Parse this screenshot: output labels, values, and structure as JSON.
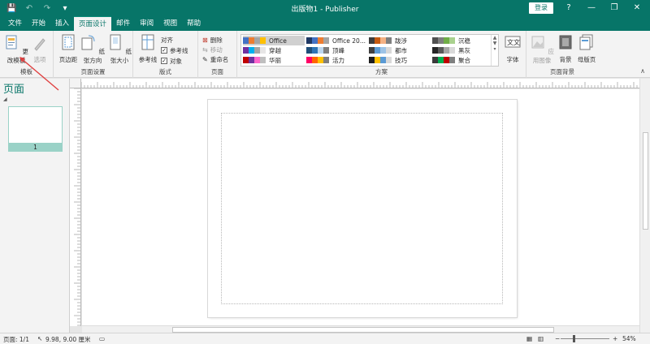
{
  "titlebar": {
    "title": "出版物1  -  Publisher",
    "login": "登录",
    "help": "?",
    "minimize": "—",
    "restore": "❐",
    "close": "✕",
    "qat": [
      "💾",
      "↶",
      "↷",
      "▾"
    ]
  },
  "tabs": [
    "文件",
    "开始",
    "插入",
    "页面设计",
    "邮件",
    "审阅",
    "视图",
    "帮助"
  ],
  "active_tab": "页面设计",
  "ribbon": {
    "template_group": {
      "label": "模板",
      "change_template": "更改模板",
      "options": "选项"
    },
    "page_setup_group": {
      "label": "页面设置",
      "margins": "页边距",
      "orientation": "纸张方向",
      "size": "纸张大小"
    },
    "layout_group": {
      "label": "版式",
      "guides": "参考线",
      "align": "对齐",
      "show_guides": "参考线",
      "show_objects": "对象"
    },
    "pages_group": {
      "label": "页面",
      "delete": "删除",
      "move": "移动",
      "rename": "重命名"
    },
    "schemes_group": {
      "label": "方案",
      "schemes": [
        {
          "name": "Office",
          "colors": [
            "#4472c4",
            "#ed7d31",
            "#a5a5a5",
            "#ffc000"
          ]
        },
        {
          "name": "Office 20...",
          "colors": [
            "#1f3864",
            "#4472c4",
            "#ed7d31",
            "#a5a5a5"
          ]
        },
        {
          "name": "跋涉",
          "colors": [
            "#3d3d3d",
            "#c55a11",
            "#f4b183",
            "#7f7f7f"
          ]
        },
        {
          "name": "沉稳",
          "colors": [
            "#505050",
            "#7f7f7f",
            "#70ad47",
            "#a9d18e"
          ]
        },
        {
          "name": "穿越",
          "colors": [
            "#7030a0",
            "#00b0f0",
            "#a5a5a5",
            "#e7e6e6"
          ]
        },
        {
          "name": "顶峰",
          "colors": [
            "#1f4e79",
            "#2e75b6",
            "#bdd7ee",
            "#7f7f7f"
          ]
        },
        {
          "name": "都市",
          "colors": [
            "#404040",
            "#5b9bd5",
            "#9dc3e6",
            "#d9d9d9"
          ]
        },
        {
          "name": "黑灰",
          "colors": [
            "#262626",
            "#595959",
            "#a6a6a6",
            "#d9d9d9"
          ]
        },
        {
          "name": "华丽",
          "colors": [
            "#c00000",
            "#7030a0",
            "#ff66cc",
            "#bfbfbf"
          ]
        },
        {
          "name": "活力",
          "colors": [
            "#ff0066",
            "#ff6600",
            "#ffc000",
            "#7f7f7f"
          ]
        },
        {
          "name": "技巧",
          "colors": [
            "#1f1f1f",
            "#ffc000",
            "#5b9bd5",
            "#d9d9d9"
          ]
        },
        {
          "name": "聚合",
          "colors": [
            "#3b3b3b",
            "#00b050",
            "#c00000",
            "#7f7f7f"
          ]
        }
      ],
      "fonts": "字体"
    },
    "background_group": {
      "label": "页面背景",
      "apply_image": "应用图像",
      "background": "背景",
      "master_page": "母版页"
    }
  },
  "navpane": {
    "title": "页面",
    "page_number": "1"
  },
  "status": {
    "page": "页面: 1/1",
    "position": "9.98, 9.00 厘米",
    "zoom": "54%",
    "zoom_minus": "−",
    "zoom_plus": "+"
  },
  "colors": {
    "brand": "#077568",
    "thumb_highlight": "#9ad2c7",
    "annotation_arrow": "#e04040"
  }
}
